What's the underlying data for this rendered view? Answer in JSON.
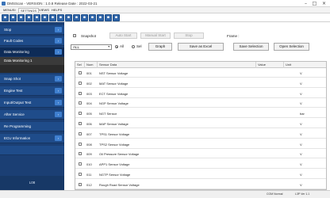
{
  "window": {
    "title": "DMSScan - VERSION : 1.0.8 Release Date : 2022-03-21",
    "minimize_glyph": "–",
    "maximize_glyph": "□",
    "close_glyph": "×"
  },
  "menu": {
    "tabs": [
      {
        "label": "MENUSI"
      },
      {
        "label": "SETTINGS"
      },
      {
        "label": "VIEWS"
      },
      {
        "label": "HELPS"
      }
    ]
  },
  "toolbar": {
    "buttons": [
      {
        "icon": "save-icon",
        "glyph": "▪"
      },
      {
        "icon": "open-icon",
        "glyph": "▪"
      },
      {
        "icon": "print-icon",
        "glyph": "▪"
      },
      {
        "icon": "connect-icon",
        "glyph": "▪"
      },
      {
        "icon": "disconnect-icon",
        "glyph": "▪"
      },
      {
        "icon": "record-icon",
        "glyph": "▪"
      },
      {
        "icon": "graph-icon",
        "glyph": "▪"
      },
      {
        "icon": "table-icon",
        "glyph": "▪"
      },
      {
        "icon": "settings-icon",
        "glyph": "▪"
      },
      {
        "icon": "refresh-icon",
        "glyph": "▪"
      },
      {
        "icon": "export-icon",
        "glyph": "▪"
      },
      {
        "icon": "import-icon",
        "glyph": "▪"
      },
      {
        "icon": "filter-icon",
        "glyph": "▪"
      },
      {
        "icon": "info-icon",
        "glyph": "▪"
      },
      {
        "icon": "exit-icon",
        "glyph": "▪"
      }
    ]
  },
  "sidebar": {
    "items": [
      {
        "label": "Stop",
        "chevron": "›"
      },
      {
        "label": "Fault Codes",
        "chevron": "›"
      },
      {
        "label": "Data Monitoring",
        "chevron": "›"
      }
    ],
    "sub_items": [
      {
        "label": "Data Monitoring 1"
      },
      {
        "label": ""
      }
    ],
    "items_lower": [
      {
        "label": "Snap Shot",
        "chevron": "›"
      },
      {
        "label": "Engine Test",
        "chevron": "›"
      },
      {
        "label": "Input/Output Test",
        "chevron": "›"
      },
      {
        "label": "After Service",
        "chevron": "›"
      },
      {
        "label": "Re Programming",
        "chevron": ""
      },
      {
        "label": "ECU Information",
        "chevron": "›"
      },
      {
        "label": "",
        "chevron": ""
      }
    ],
    "footer": "L08"
  },
  "controls": {
    "snapshot_label": "Snapshot",
    "auto_start": "Auto Start",
    "manual_start": "Manual Start",
    "stop": "Stop",
    "frame_label": "Frame :",
    "filter_value": "ALL",
    "radio_all": "All",
    "radio_sel": "Sel",
    "graph": "Graph",
    "save_excel": "Save as Excel",
    "save_selection": "Save Selection",
    "open_selection": "Open Selection"
  },
  "grid": {
    "columns": [
      "Sel",
      "Num",
      "Sensor Data",
      "Value",
      "Unit"
    ],
    "rows": [
      {
        "num": "001",
        "name": "NST Sensor Voltage",
        "value": "",
        "unit": "V"
      },
      {
        "num": "002",
        "name": "MAT Sensor Voltage",
        "value": "",
        "unit": "V"
      },
      {
        "num": "003",
        "name": "ECT Sensor Voltage",
        "value": "",
        "unit": "V"
      },
      {
        "num": "004",
        "name": "NGP Sensor Voltage",
        "value": "",
        "unit": "V"
      },
      {
        "num": "005",
        "name": "NGT Sensor",
        "value": "",
        "unit": "bar"
      },
      {
        "num": "006",
        "name": "MAP Sensor Voltage",
        "value": "",
        "unit": "V"
      },
      {
        "num": "007",
        "name": "TPS1 Sensor Voltage",
        "value": "",
        "unit": "V"
      },
      {
        "num": "008",
        "name": "TPS2 Sensor Voltage",
        "value": "",
        "unit": "V"
      },
      {
        "num": "009",
        "name": "Oil Pressure Sensor Voltage",
        "value": "",
        "unit": "V"
      },
      {
        "num": "010",
        "name": "APP1 Sensor Voltage",
        "value": "",
        "unit": "V"
      },
      {
        "num": "011",
        "name": "NGTP Sensor Voltage",
        "value": "",
        "unit": "V"
      },
      {
        "num": "012",
        "name": "Rough Road Sensor Voltage",
        "value": "",
        "unit": "V"
      }
    ]
  },
  "status": {
    "left": "",
    "right_1": "COM Normal",
    "right_2": "L3P Ver 1.1"
  }
}
